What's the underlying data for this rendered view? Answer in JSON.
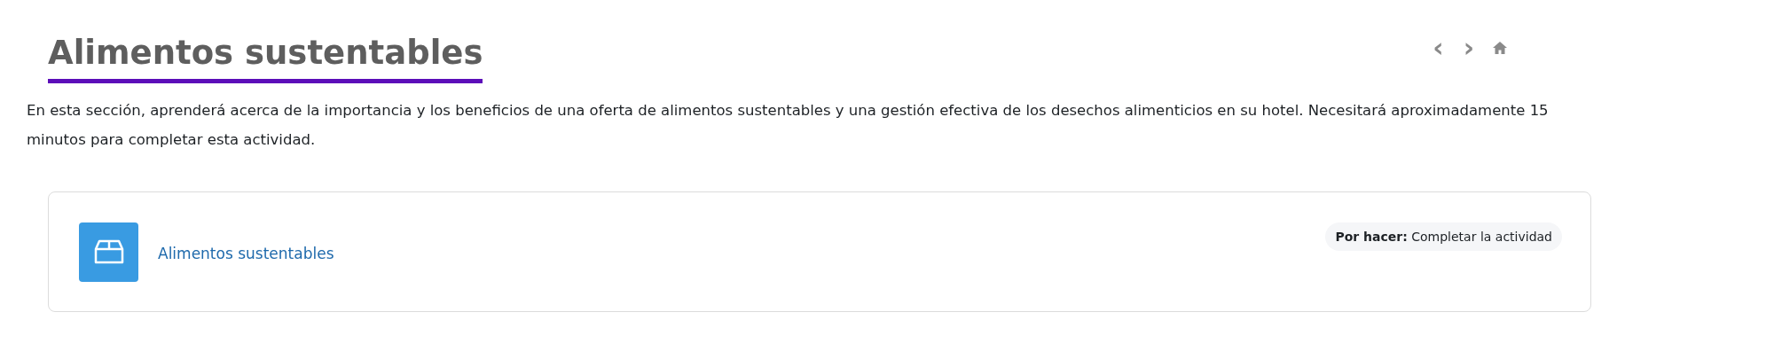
{
  "header": {
    "title": "Alimentos sustentables",
    "nav": [
      "‹",
      "›"
    ]
  },
  "description": "En esta sección, aprenderá acerca de la importancia y los beneficios de una oferta de alimentos sustentables y una gestión efectiva de los desechos alimenticios en su hotel. Necesitará aproximadamente 15 minutos para completar esta actividad.",
  "activities": [
    {
      "name": "Alimentos sustentables",
      "completion": "**Por hacer:** Completar la actividad"
    }
  ]
}
